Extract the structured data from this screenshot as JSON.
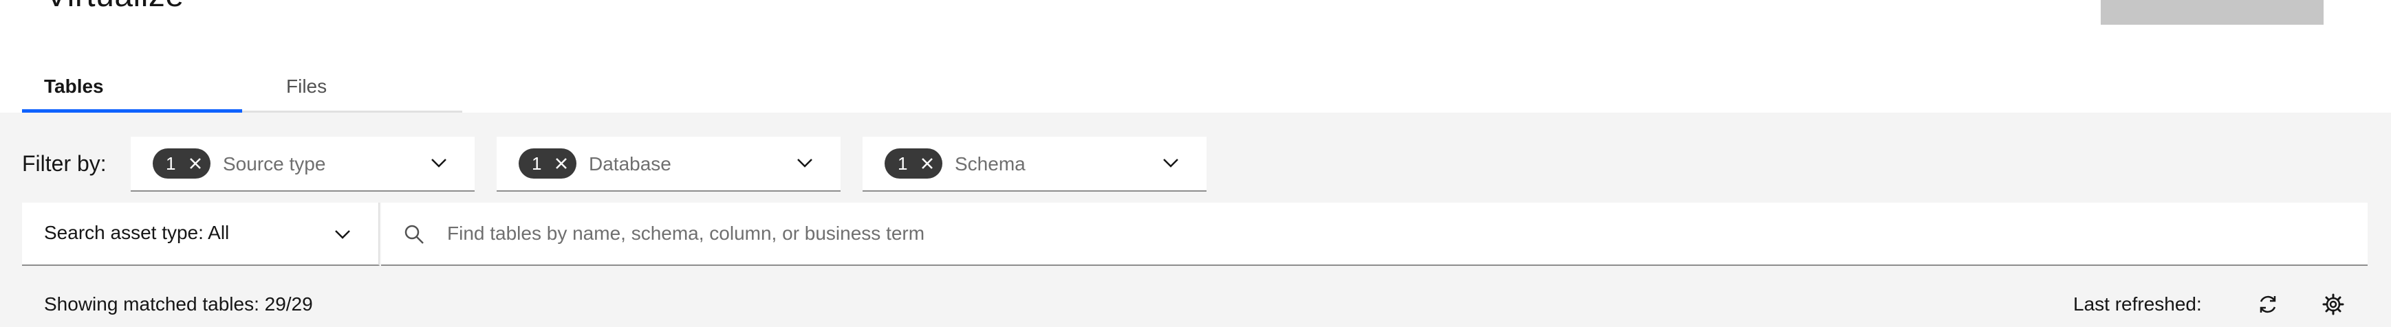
{
  "header": {
    "title": "Virtualize"
  },
  "tabs": [
    {
      "label": "Tables"
    },
    {
      "label": "Files"
    }
  ],
  "filters": {
    "label": "Filter by:",
    "dropdowns": [
      {
        "count": "1",
        "placeholder": "Source type"
      },
      {
        "count": "1",
        "placeholder": "Database"
      },
      {
        "count": "1",
        "placeholder": "Schema"
      }
    ]
  },
  "search": {
    "asset_type_label": "Search asset type: All",
    "placeholder": "Find tables by name, schema, column, or business term"
  },
  "status": {
    "matched": "Showing matched tables: 29/29",
    "last_refreshed": "Last refreshed:"
  },
  "icons": {
    "search": "search-icon",
    "refresh": "refresh-icon",
    "settings": "gear-icon",
    "chevron": "chevron-down-icon",
    "close": "close-icon"
  },
  "colors": {
    "accent": "#0f62fe",
    "tag_background": "#393939",
    "panel_background": "#f4f4f4"
  }
}
